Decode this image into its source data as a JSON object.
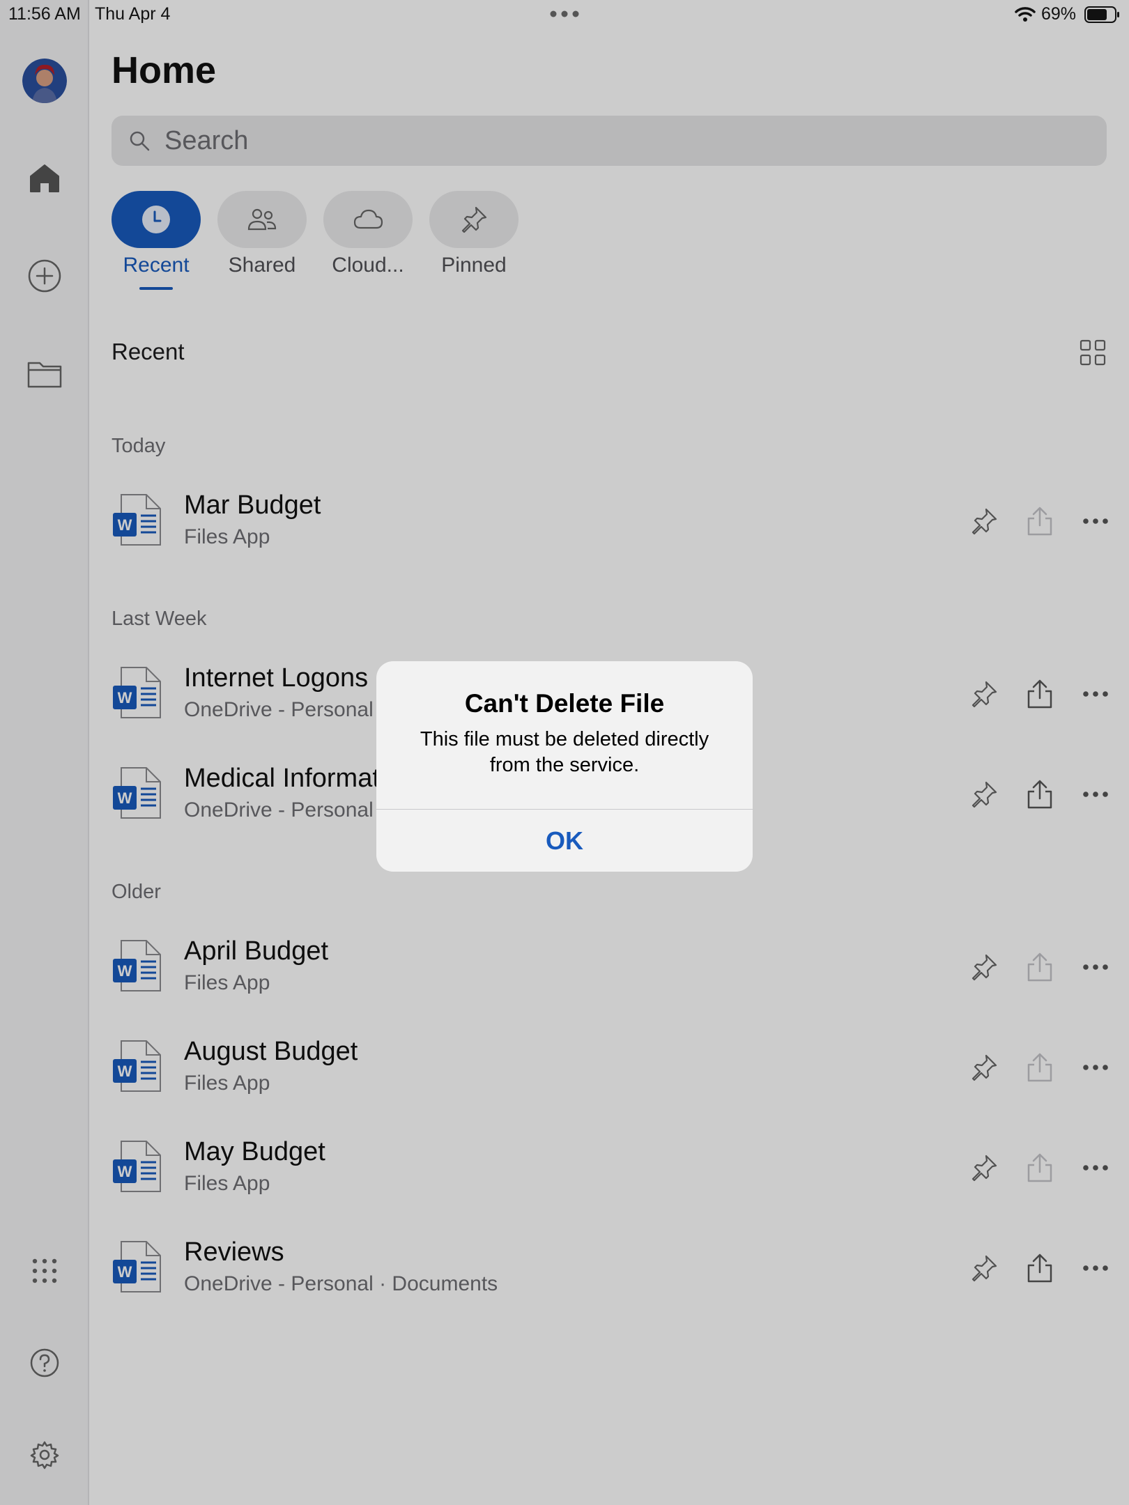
{
  "status_bar": {
    "time": "11:56 AM",
    "date": "Thu Apr 4",
    "battery_percent": "69%"
  },
  "rail": {
    "items": [
      "avatar",
      "home-icon",
      "plus-circle-icon",
      "folder-icon",
      "apps-grid-icon",
      "help-icon",
      "settings-gear-icon"
    ]
  },
  "header": {
    "title": "Home"
  },
  "search": {
    "placeholder": "Search"
  },
  "tabs": [
    {
      "label": "Recent",
      "icon": "clock-icon",
      "active": true
    },
    {
      "label": "Shared",
      "icon": "people-icon",
      "active": false
    },
    {
      "label": "Cloud...",
      "icon": "cloud-icon",
      "active": false
    },
    {
      "label": "Pinned",
      "icon": "pin-icon",
      "active": false
    }
  ],
  "list": {
    "section_title": "Recent",
    "groups": {
      "today": "Today",
      "last_week": "Last Week",
      "older": "Older"
    },
    "files": [
      {
        "name": "Mar Budget",
        "location": "Files App"
      },
      {
        "name": "Internet Logons",
        "location": "OneDrive - Personal"
      },
      {
        "name": "Medical Informat",
        "location": "OneDrive - Personal"
      },
      {
        "name": "April Budget",
        "location": "Files App"
      },
      {
        "name": "August Budget",
        "location": "Files App"
      },
      {
        "name": "May Budget",
        "location": "Files App"
      },
      {
        "name": "Reviews",
        "location": "OneDrive - Personal · Documents"
      }
    ]
  },
  "alert": {
    "title": "Can't Delete File",
    "message": "This file must be deleted directly from the service.",
    "ok_label": "OK"
  },
  "colors": {
    "accent": "#185abd",
    "word_blue": "#185abd"
  }
}
